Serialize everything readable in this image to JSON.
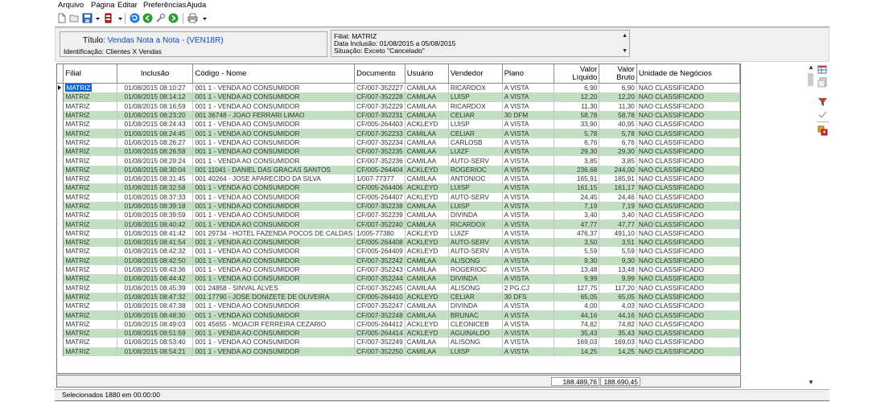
{
  "menu": [
    "Arquivo",
    "Página",
    "Editar",
    "Preferências",
    "Ajuda"
  ],
  "toolbar_icons": [
    "new-doc-icon",
    "open-folder-icon",
    "save-icon",
    "dropdown-arrow-icon",
    "print-preview-icon",
    "dropdown-arrow-icon",
    "refresh-icon",
    "back-icon",
    "wrench-icon",
    "forward-icon",
    "printer-icon",
    "dropdown-arrow-icon"
  ],
  "report": {
    "title_label": "Título:",
    "title_value": "Vendas Nota a Nota - (VEN18R)",
    "identification": "Identificação: Clientes X Vendas"
  },
  "filters": [
    "Filial: MATRIZ",
    "Data Inclusão: 01/08/2015 a 05/08/2015",
    "Situação: Exceto \"Cancelado\""
  ],
  "columns": {
    "filial": "Filial",
    "inclusao": "Inclusão",
    "codigo_nome": "Código - Nome",
    "documento": "Documento",
    "usuario": "Usuário",
    "vendedor": "Vendedor",
    "plano": "Plano",
    "valor_liquido_1": "Valor",
    "valor_liquido_2": "Líquido",
    "valor_bruto_1": "Valor",
    "valor_bruto_2": "Bruto",
    "unidade": "Unidade de Negócios"
  },
  "rows": [
    [
      "MATRIZ",
      "01/08/2015 08:10:27",
      "001  1 - VENDA AO CONSUMIDOR",
      "CF/007-352227",
      "CAMILAA",
      "RICARDOX",
      "A VISTA",
      "6,90",
      "6,90",
      "NAO CLASSIFICADO"
    ],
    [
      "MATRIZ",
      "01/08/2015 08:14:12",
      "001  1 - VENDA AO CONSUMIDOR",
      "CF/007-352228",
      "CAMILAA",
      "LUISP",
      "A VISTA",
      "12,20",
      "12,20",
      "NAO CLASSIFICADO"
    ],
    [
      "MATRIZ",
      "01/08/2015 08:16:59",
      "001  1 - VENDA AO CONSUMIDOR",
      "CF/007-352229",
      "CAMILAA",
      "RICARDOX",
      "A VISTA",
      "11,30",
      "11,30",
      "NAO CLASSIFICADO"
    ],
    [
      "MATRIZ",
      "01/08/2015 08:23:20",
      "001 36748 - JOAO FERRARI LIMAO",
      "CF/007-352231",
      "CAMILAA",
      "CELIAR",
      "30 DFM",
      "58,78",
      "58,78",
      "NAO CLASSIFICADO"
    ],
    [
      "MATRIZ",
      "01/08/2015 08:24:43",
      "001  1 - VENDA AO CONSUMIDOR",
      "CF/005-264403",
      "ACKLEYD",
      "LUISP",
      "A VISTA",
      "33,90",
      "40,95",
      "NAO CLASSIFICADO"
    ],
    [
      "MATRIZ",
      "01/08/2015 08:24:45",
      "001  1 - VENDA AO CONSUMIDOR",
      "CF/007-352233",
      "CAMILAA",
      "CELIAR",
      "A VISTA",
      "5,78",
      "5,78",
      "NAO CLASSIFICADO"
    ],
    [
      "MATRIZ",
      "01/08/2015 08:26:27",
      "001  1 - VENDA AO CONSUMIDOR",
      "CF/007-352234",
      "CAMILAA",
      "CARLOSB",
      "A VISTA",
      "6,76",
      "6,76",
      "NAO CLASSIFICADO"
    ],
    [
      "MATRIZ",
      "01/08/2015 08:26:58",
      "001  1 - VENDA AO CONSUMIDOR",
      "CF/007-352235",
      "CAMILAA",
      "LUIZF",
      "A VISTA",
      "29,30",
      "29,30",
      "NAO CLASSIFICADO"
    ],
    [
      "MATRIZ",
      "01/08/2015 08:29:24",
      "001  1 - VENDA AO CONSUMIDOR",
      "CF/007-352236",
      "CAMILAA",
      "AUTO-SERV",
      "A VISTA",
      "3,85",
      "3,85",
      "NAO CLASSIFICADO"
    ],
    [
      "MATRIZ",
      "01/08/2015 08:30:04",
      "001 11041 - DANIEL DAS GRACAS SANTOS",
      "CF/005-264404",
      "ACKLEYD",
      "ROGERIOC",
      "A VISTA",
      "236,68",
      "244,00",
      "NAO CLASSIFICADO"
    ],
    [
      "MATRIZ",
      "01/08/2015 08:31:45",
      "001 40264 - JOSE APARECIDO DA SILVA",
      "1/007-77377",
      "CAMILAA",
      "ANTONIOC",
      "A VISTA",
      "165,91",
      "165,91",
      "NAO CLASSIFICADO"
    ],
    [
      "MATRIZ",
      "01/08/2015 08:32:58",
      "001  1 - VENDA AO CONSUMIDOR",
      "CF/005-264406",
      "ACKLEYD",
      "LUISP",
      "A VISTA",
      "161,15",
      "161,17",
      "NAO CLASSIFICADO"
    ],
    [
      "MATRIZ",
      "01/08/2015 08:37:33",
      "001  1 - VENDA AO CONSUMIDOR",
      "CF/005-264407",
      "ACKLEYD",
      "AUTO-SERV",
      "A VISTA",
      "24,45",
      "24,46",
      "NAO CLASSIFICADO"
    ],
    [
      "MATRIZ",
      "01/08/2015 08:39:18",
      "001  1 - VENDA AO CONSUMIDOR",
      "CF/007-352238",
      "CAMILAA",
      "LUISP",
      "A VISTA",
      "7,19",
      "7,19",
      "NAO CLASSIFICADO"
    ],
    [
      "MATRIZ",
      "01/08/2015 08:39:59",
      "001  1 - VENDA AO CONSUMIDOR",
      "CF/007-352239",
      "CAMILAA",
      "DIVINDA",
      "A VISTA",
      "3,40",
      "3,40",
      "NAO CLASSIFICADO"
    ],
    [
      "MATRIZ",
      "01/08/2015 08:40:42",
      "001  1 - VENDA AO CONSUMIDOR",
      "CF/007-352240",
      "CAMILAA",
      "RICARDOX",
      "A VISTA",
      "47,77",
      "47,77",
      "NAO CLASSIFICADO"
    ],
    [
      "MATRIZ",
      "01/08/2015 08:41:42",
      "001 29734 - HOTEL FAZENDA POCOS DE CALDAS",
      "1/005-77380",
      "ACKLEYD",
      "LUIZF",
      "A VISTA",
      "476,37",
      "491,10",
      "NAO CLASSIFICADO"
    ],
    [
      "MATRIZ",
      "01/08/2015 08:41:54",
      "001  1 - VENDA AO CONSUMIDOR",
      "CF/005-264408",
      "ACKLEYD",
      "AUTO-SERV",
      "A VISTA",
      "3,50",
      "3,51",
      "NAO CLASSIFICADO"
    ],
    [
      "MATRIZ",
      "01/08/2015 08:42:32",
      "001  1 - VENDA AO CONSUMIDOR",
      "CF/005-264409",
      "ACKLEYD",
      "AUTO-SERV",
      "A VISTA",
      "5,59",
      "5,59",
      "NAO CLASSIFICADO"
    ],
    [
      "MATRIZ",
      "01/08/2015 08:42:50",
      "001  1 - VENDA AO CONSUMIDOR",
      "CF/007-352242",
      "CAMILAA",
      "ALISONG",
      "A VISTA",
      "9,30",
      "9,30",
      "NAO CLASSIFICADO"
    ],
    [
      "MATRIZ",
      "01/08/2015 08:43:36",
      "001  1 - VENDA AO CONSUMIDOR",
      "CF/007-352243",
      "CAMILAA",
      "ROGERIOC",
      "A VISTA",
      "13,48",
      "13,48",
      "NAO CLASSIFICADO"
    ],
    [
      "MATRIZ",
      "01/08/2015 08:44:42",
      "001  1 - VENDA AO CONSUMIDOR",
      "CF/007-352244",
      "CAMILAA",
      "DIVINDA",
      "A VISTA",
      "9,99",
      "9,99",
      "NAO CLASSIFICADO"
    ],
    [
      "MATRIZ",
      "01/08/2015 08:45:39",
      "001 24858 - SINVAL ALVES",
      "CF/007-352245",
      "CAMILAA",
      "ALISONG",
      "2 PG.CJ",
      "127,75",
      "117,20",
      "NAO CLASSIFICADO"
    ],
    [
      "MATRIZ",
      "01/08/2015 08:47:32",
      "001 17790 - JOSE DONIZETE DE OLIVEIRA",
      "CF/005-264410",
      "ACKLEYD",
      "CELIAR",
      "30 DFS",
      "65,05",
      "65,05",
      "NAO CLASSIFICADO"
    ],
    [
      "MATRIZ",
      "01/08/2015 08:47:38",
      "001  1 - VENDA AO CONSUMIDOR",
      "CF/007-352247",
      "CAMILAA",
      "DIVINDA",
      "A VISTA",
      "4,00",
      "4,03",
      "NAO CLASSIFICADO"
    ],
    [
      "MATRIZ",
      "01/08/2015 08:48:30",
      "001  1 - VENDA AO CONSUMIDOR",
      "CF/007-352248",
      "CAMILAA",
      "BRUNAC",
      "A VISTA",
      "44,16",
      "44,16",
      "NAO CLASSIFICADO"
    ],
    [
      "MATRIZ",
      "01/08/2015 08:49:03",
      "001 45655 - MOACIR FERREIRA CEZARIO",
      "CF/005-264412",
      "ACKLEYD",
      "CLEONICEB",
      "A VISTA",
      "74,82",
      "74,82",
      "NAO CLASSIFICADO"
    ],
    [
      "MATRIZ",
      "01/08/2015 08:51:59",
      "001  1 - VENDA AO CONSUMIDOR",
      "CF/005-264414",
      "ACKLEYD",
      "AGUINALDO",
      "A VISTA",
      "35,43",
      "35,43",
      "NAO CLASSIFICADO"
    ],
    [
      "MATRIZ",
      "01/08/2015 08:53:40",
      "001  1 - VENDA AO CONSUMIDOR",
      "CF/007-352249",
      "CAMILAA",
      "ALISONG",
      "A VISTA",
      "169,03",
      "169,03",
      "NAO CLASSIFICADO"
    ],
    [
      "MATRIZ",
      "01/08/2015 08:54:21",
      "001  1 - VENDA AO CONSUMIDOR",
      "CF/007-352250",
      "CAMILAA",
      "LUISP",
      "A VISTA",
      "14,25",
      "14,25",
      "NAO CLASSIFICADO"
    ]
  ],
  "totals": {
    "valor_liquido": "188.489,76",
    "valor_bruto": "188.690,45"
  },
  "status": "Selecionados 1880 em 00:00:00",
  "side_icons": [
    "grid-settings-icon",
    "export-icon",
    "filter-icon",
    "check-icon",
    "group-icon"
  ],
  "colors": {
    "row_alt": "#c3dfc3",
    "selection": "#0a64d8",
    "title_value": "#0a4bc8"
  }
}
